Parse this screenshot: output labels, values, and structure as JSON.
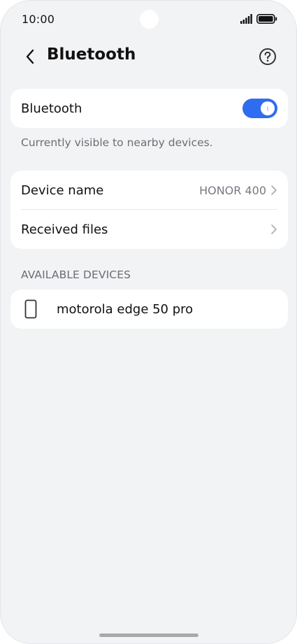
{
  "status_bar": {
    "time": "10:00",
    "icons": [
      "signal-icon",
      "battery-icon"
    ]
  },
  "header": {
    "title": "Bluetooth",
    "back_icon": "chevron-left-icon",
    "help_icon": "help-circle-icon"
  },
  "bluetooth_card": {
    "label": "Bluetooth",
    "toggle_on": true,
    "toggle_color": "#2f6cf0"
  },
  "visibility_text": "Currently visible to nearby devices.",
  "settings_card": {
    "device_name_label": "Device name",
    "device_name_value": "HONOR 400",
    "received_files_label": "Received files"
  },
  "available_devices": {
    "header": "AVAILABLE DEVICES",
    "items": [
      {
        "name": "motorola edge 50 pro",
        "icon": "phone-icon"
      }
    ]
  }
}
